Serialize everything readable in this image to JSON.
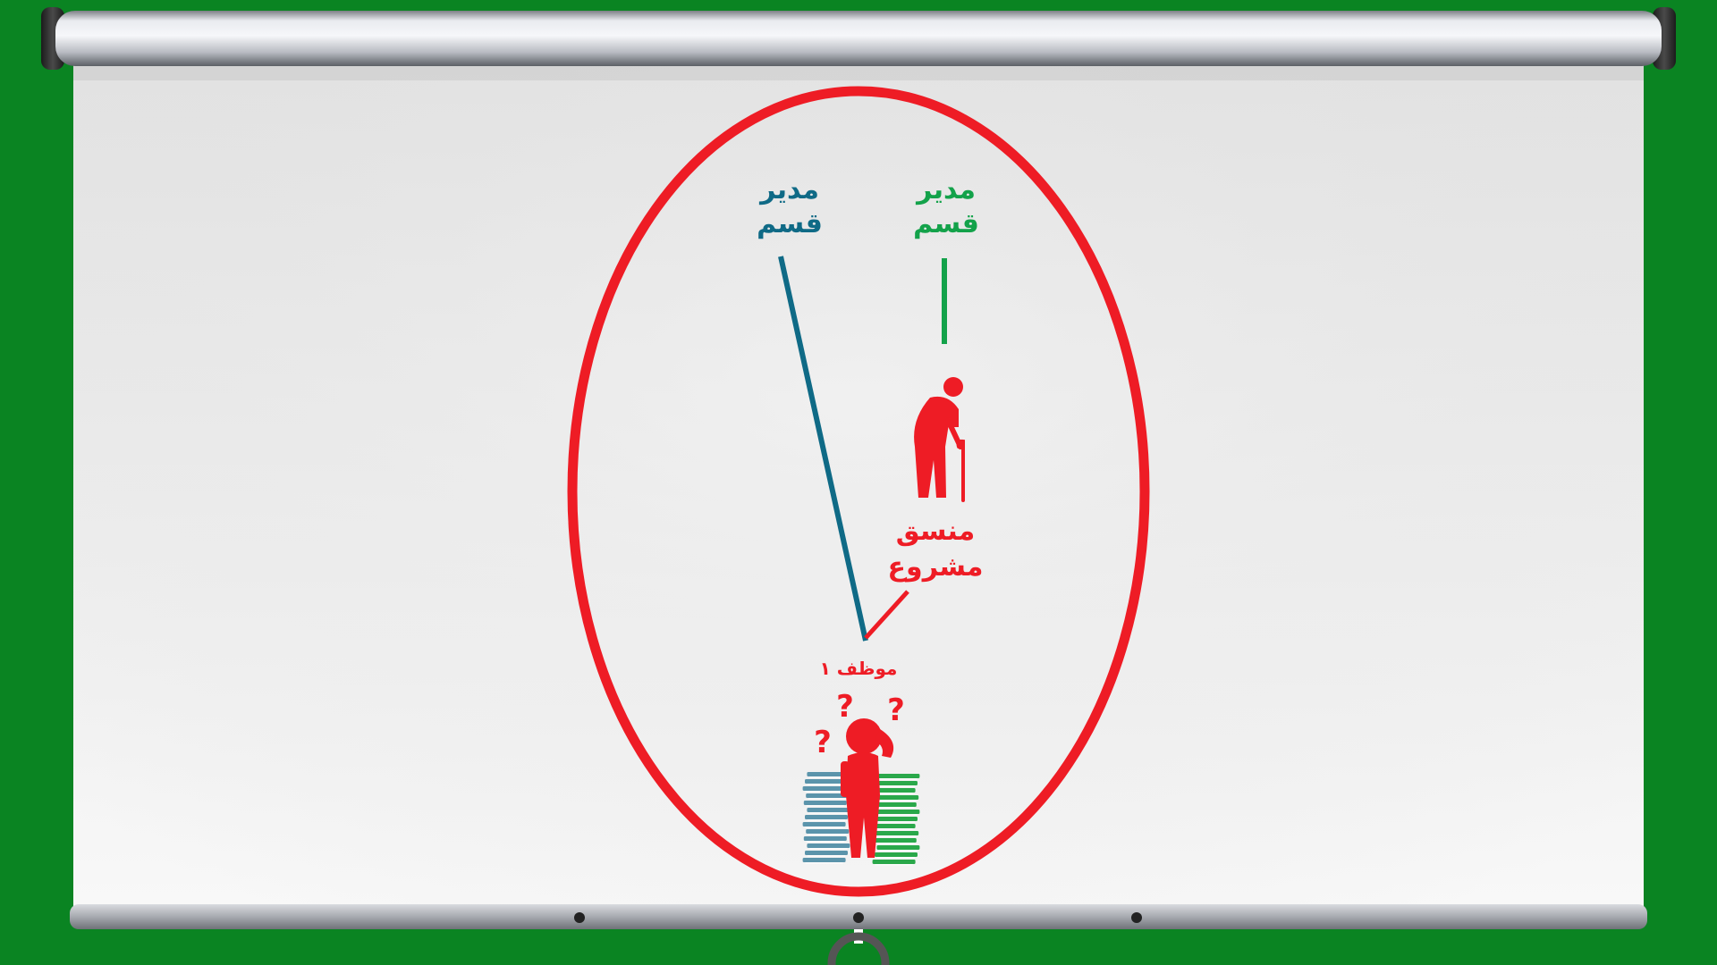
{
  "diagram": {
    "manager_left": {
      "line1": "مدير",
      "line2": "قسم",
      "color": "#0f6a86"
    },
    "manager_right": {
      "line1": "مدير",
      "line2": "قسم",
      "color": "#13a24a"
    },
    "coordinator": {
      "line1": "منسق",
      "line2": "مشروع",
      "color": "#ee1c25"
    },
    "employee": {
      "label": "موظف ١",
      "color": "#ee1c25"
    },
    "question_mark": "?",
    "icons": [
      "elderly-person-icon",
      "confused-employee-icon",
      "paper-stack-icon"
    ]
  },
  "theme": {
    "background": "#0a8422",
    "screen": "#ececec",
    "ellipse": "#ee1c25"
  }
}
